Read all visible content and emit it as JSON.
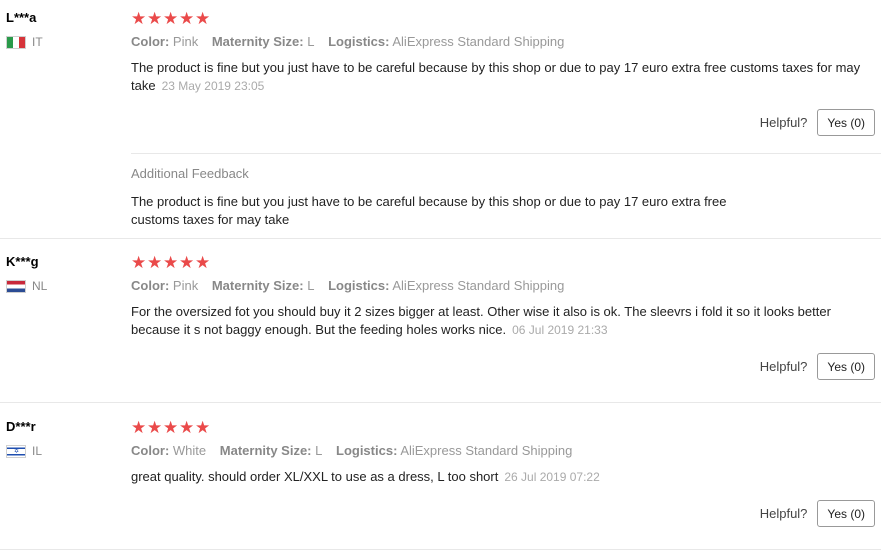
{
  "helpful_label": "Helpful?",
  "star_color": "#ea4a4a",
  "reviews": [
    {
      "user": "L***a",
      "country": "IT",
      "flag": "italy-flag",
      "stars": "★★★★★",
      "color_label": "Color:",
      "color": "Pink",
      "size_label": "Maternity Size:",
      "size": "L",
      "logistics_label": "Logistics:",
      "logistics": "AliExpress Standard Shipping",
      "text": "The product is fine but you just have to be careful because by this shop or due to pay 17 euro extra free customs taxes for may take",
      "date": "23 May 2019 23:05",
      "yes": "Yes (0)",
      "additional_title": "Additional Feedback",
      "additional_text": "The product is fine but you just have to be careful because by this shop or due to pay 17 euro extra free customs taxes for may take"
    },
    {
      "user": "K***g",
      "country": "NL",
      "flag": "netherlands-flag",
      "stars": "★★★★★",
      "color_label": "Color:",
      "color": "Pink",
      "size_label": "Maternity Size:",
      "size": "L",
      "logistics_label": "Logistics:",
      "logistics": "AliExpress Standard Shipping",
      "text": "For the oversized fot you should buy it 2 sizes bigger at least. Other wise it also is ok. The sleevrs i fold it so it looks better because it s not baggy enough. But the feeding holes works nice.",
      "date": "06 Jul 2019 21:33",
      "yes": "Yes (0)"
    },
    {
      "user": "D***r",
      "country": "IL",
      "flag": "israel-flag",
      "stars": "★★★★★",
      "color_label": "Color:",
      "color": "White",
      "size_label": "Maternity Size:",
      "size": "L",
      "logistics_label": "Logistics:",
      "logistics": "AliExpress Standard Shipping",
      "text": "great quality. should order XL/XXL to use as a dress, L too short",
      "date": "26 Jul 2019 07:22",
      "yes": "Yes (0)"
    }
  ]
}
